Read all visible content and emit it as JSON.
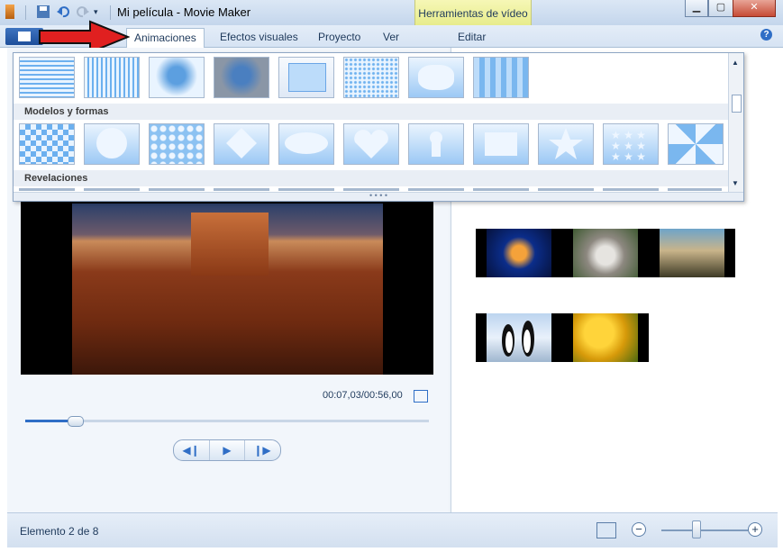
{
  "window": {
    "title": "Mi película - Movie Maker"
  },
  "ribbon": {
    "context_tab": "Herramientas de vídeo",
    "tabs": [
      "Animaciones",
      "Efectos visuales",
      "Proyecto",
      "Ver",
      "Editar"
    ],
    "active_tab": "Animaciones"
  },
  "gallery": {
    "sections": [
      "Modelos y formas",
      "Revelaciones"
    ],
    "scroll_up_icon": "chevron-up-icon",
    "scroll_down_icon": "chevron-down-icon"
  },
  "player": {
    "time": "00:07,03/00:56,00",
    "position_fraction": 0.125
  },
  "status": {
    "text": "Elemento 2 de 8"
  },
  "colors": {
    "accent": "#2f6ec6",
    "arrow": "#e02020",
    "context_tab": "#eaf08f"
  }
}
